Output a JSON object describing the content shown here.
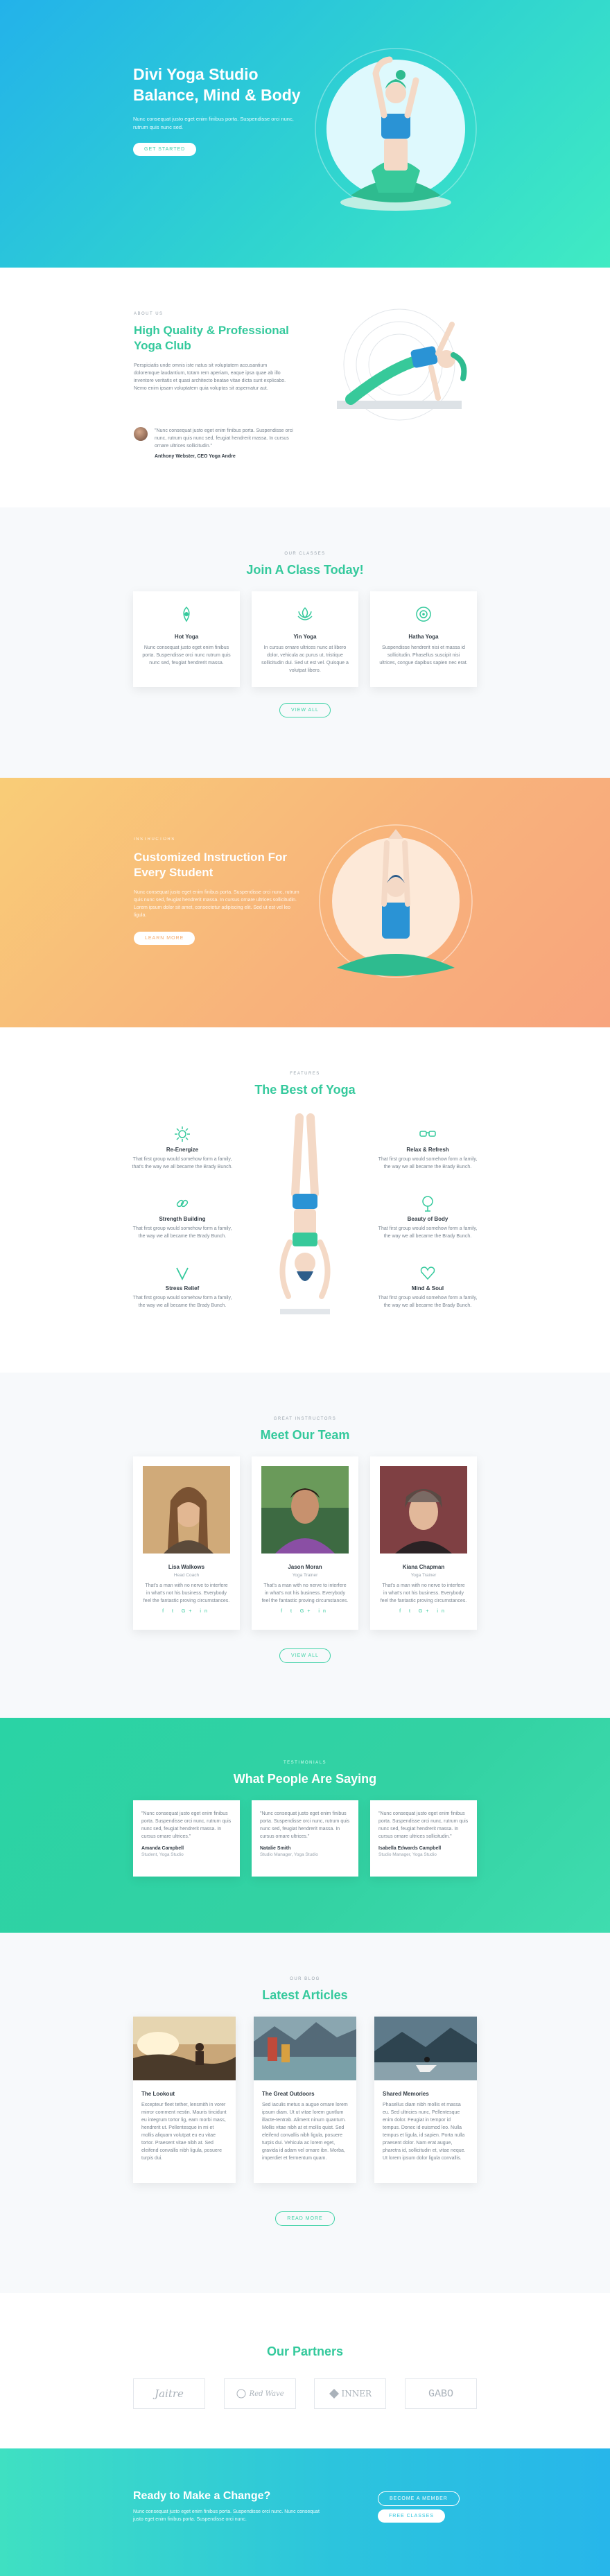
{
  "hero": {
    "title1": "Divi Yoga Studio",
    "title2": "Balance, Mind & Body",
    "text": "Nunc consequat justo eget enim finibus porta. Suspendisse orci nunc, rutrum quis nunc sed.",
    "button": "Get Started"
  },
  "about": {
    "eyebrow": "About Us",
    "title": "High Quality & Professional Yoga Club",
    "text": "Perspiciatis unde omnis iste natus sit voluptatem accusantium doloremque laudantium, totam rem aperiam, eaque ipsa quae ab illo inventore veritatis et quasi architecto beatae vitae dicta sunt explicabo. Nemo enim ipsam voluptatem quia voluptas sit aspernatur aut.",
    "quote": "\"Nunc consequat justo eget enim finibus porta. Suspendisse orci nunc, rutrum quis nunc sed, feugiat hendrerit massa. In cursus ornare ultrices sollicitudin.\"",
    "author": "Anthony Webster, CEO Yoga Andre"
  },
  "classes": {
    "eyebrow": "Our Classes",
    "title": "Join A Class Today!",
    "cards": [
      {
        "icon": "hand-lotus-icon",
        "title": "Hot Yoga",
        "text": "Nunc consequat justo eget enim finibus porta. Suspendisse orci nunc rutrum quis nunc sed, feugiat hendrerit massa."
      },
      {
        "icon": "lotus-flower-icon",
        "title": "Yin Yoga",
        "text": "In cursus ornare ultrices nunc at libero dolor, vehicula ac purus ut, tristique sollicitudin dui. Sed ut est vel. Quisque a volutpat libero."
      },
      {
        "icon": "om-circle-icon",
        "title": "Hatha Yoga",
        "text": "Suspendisse hendrerit nisi et massa id sollicitudin. Phasellus suscipit nisi ultrices, congue dapibus sapien nec erat."
      }
    ],
    "button": "View All"
  },
  "custom": {
    "eyebrow": "Instructors",
    "title": "Customized Instruction For Every Student",
    "text": "Nunc consequat justo eget enim finibus porta. Suspendisse orci nunc, rutrum quis nunc sed, feugiat hendrerit massa. In cursus ornare ultrices sollicitudin. Lorem ipsum dolor sit amet, consectetur adipiscing elit. Sed ut est vel leo ligula.",
    "button": "Learn More"
  },
  "best": {
    "eyebrow": "Features",
    "title": "The Best of Yoga",
    "left": [
      {
        "icon": "sun-icon",
        "title": "Re-Energize",
        "text": "That first group would somehow form a family, that's the way we all became the Brady Bunch."
      },
      {
        "icon": "link-icon",
        "title": "Strength Building",
        "text": "That first group would somehow form a family, the way we all became the Brady Bunch."
      },
      {
        "icon": "check-icon",
        "title": "Stress Relief",
        "text": "That first group would somehow form a family, the way we all became the Brady Bunch."
      }
    ],
    "right": [
      {
        "icon": "glasses-icon",
        "title": "Relax & Refresh",
        "text": "That first group would somehow form a family, the way we all became the Brady Bunch."
      },
      {
        "icon": "tree-icon",
        "title": "Beauty of Body",
        "text": "That first group would somehow form a family, the way we all became the Brady Bunch."
      },
      {
        "icon": "heart-icon",
        "title": "Mind & Soul",
        "text": "That first group would somehow form a family, the way we all became the Brady Bunch."
      }
    ]
  },
  "team": {
    "eyebrow": "Great Instructors",
    "title": "Meet Our Team",
    "members": [
      {
        "name": "Lisa Walkows",
        "role": "Head Coach",
        "text": "That's a man with no nerve to interfere in what's not his business. Everybody feel the fantastic proving circumstances.",
        "socials": "f t G+ in"
      },
      {
        "name": "Jason Moran",
        "role": "Yoga Trainer",
        "text": "That's a man with no nerve to interfere in what's not his business. Everybody feel the fantastic proving circumstances.",
        "socials": "f t G+ in"
      },
      {
        "name": "Kiana Chapman",
        "role": "Yoga Trainer",
        "text": "That's a man with no nerve to interfere in what's not his business. Everybody feel the fantastic proving circumstances.",
        "socials": "f t G+ in"
      }
    ],
    "button": "View All"
  },
  "testimonials": {
    "eyebrow": "Testimonials",
    "title": "What People Are Saying",
    "items": [
      {
        "text": "\"Nunc consequat justo eget enim finibus porta. Suspendisse orci nunc, rutrum quis nunc sed, feugiat hendrerit massa. In cursus ornare ultrices.\"",
        "name": "Amanda Campbell",
        "role": "Student, Yoga Studio"
      },
      {
        "text": "\"Nunc consequat justo eget enim finibus porta. Suspendisse orci nunc, rutrum quis nunc sed, feugiat hendrerit massa. In cursus ornare ultrices.\"",
        "name": "Natalie Smith",
        "role": "Studio Manager, Yoga Studio"
      },
      {
        "text": "\"Nunc consequat justo eget enim finibus porta. Suspendisse orci nunc, rutrum quis nunc sed, feugiat hendrerit massa. In cursus ornare ultrices sollicitudin.\"",
        "name": "Isabella Edwards Campbell",
        "role": "Studio Manager, Yoga Studio"
      }
    ]
  },
  "articles": {
    "eyebrow": "Our Blog",
    "title": "Latest Articles",
    "items": [
      {
        "title": "The Lookout",
        "text": "Excepteur fleet tether, lensmith in vorer mirror comment nestin. Mauris tincidunt eu integrum tortor lig, eam morbi mass, hendrerit ut. Pellentesque in mi et mollis aliquam volutpat eu eu vitae tortor. Praesent vitae nibh at. Sed eleifend convallis nibh ligula, posuere turpis dui."
      },
      {
        "title": "The Great Outdoors",
        "text": "Sed iaculis metus a augue ornare lorem ipsum diam. Ut ut vitae lorem guntlum illacte-tentrab. Aliment ninum quantum. Mollis vitae nibh at et mollis quist. Sed eleifend convallis nibh ligula, posuere turpis dui. Vehicula ac lorem eget, gravida id adam vel ornare ibn. Morba, imperdiet et fermentum quam."
      },
      {
        "title": "Shared Memories",
        "text": "Phasellus diam nibh mollis et massa eu. Sed ultricies nunc, Pellentesque enim dolor. Feugiat in tempor id tempus. Donec id euismod leo. Nulla tempus et ligula, id sapien. Porta nulla praesent dolor. Nam erat augue, pharetra id, sollicitudin et, vitae neque. Ut lorem ipsum dolor ligula convallis."
      }
    ],
    "button": "Read More"
  },
  "partners": {
    "title": "Our Partners",
    "logos": [
      "Jaitre",
      "Red Wave",
      "INNER",
      "GABO"
    ]
  },
  "cta": {
    "title": "Ready to Make a Change?",
    "text": "Nunc consequat justo eget enim finibus porta. Suspendisse orci nunc. Nunc consequat justo eget enim finibus porta. Suspendisse orci nunc.",
    "button1": "Become a Member",
    "button2": "Free Classes"
  }
}
